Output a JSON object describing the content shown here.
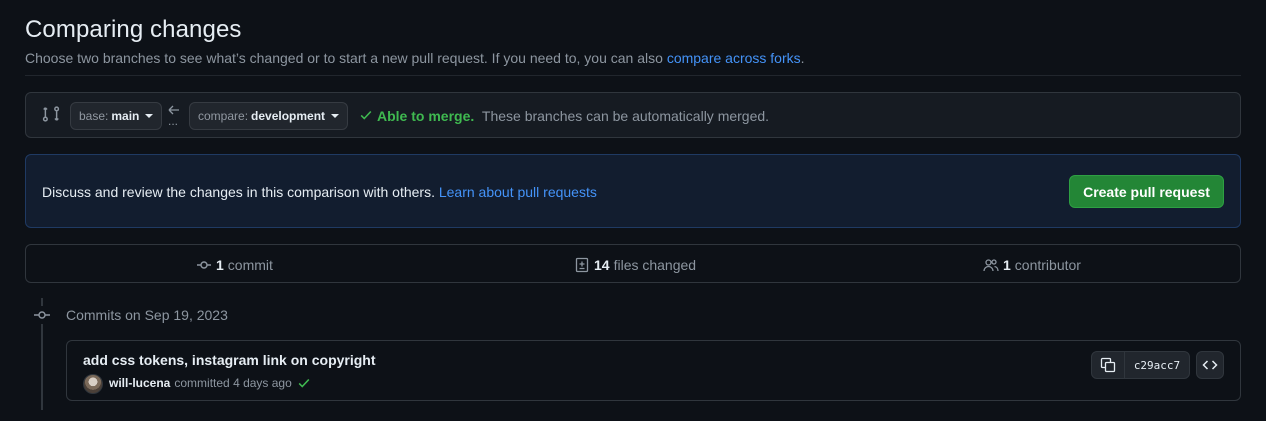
{
  "header": {
    "title": "Comparing changes",
    "subtitle_text": "Choose two branches to see what’s changed or to start a new pull request. If you need to, you can also",
    "subtitle_link": "compare across forks",
    "subtitle_end": "."
  },
  "branch_bar": {
    "base_prefix": "base:",
    "base_value": "main",
    "compare_prefix": "compare:",
    "compare_value": "development",
    "dots": "...",
    "merge_status": "Able to merge.",
    "merge_detail": "These branches can be automatically merged."
  },
  "flash": {
    "text": "Discuss and review the changes in this comparison with others.",
    "link": "Learn about pull requests",
    "button": "Create pull request"
  },
  "summary": {
    "commits_count": "1",
    "commits_label": "commit",
    "files_count": "14",
    "files_label": "files changed",
    "contributors_count": "1",
    "contributors_label": "contributor"
  },
  "timeline": {
    "date_heading": "Commits on Sep 19, 2023",
    "commits": [
      {
        "message": "add css tokens, instagram link on copyright",
        "author": "will-lucena",
        "action": "committed",
        "time": "4 days ago",
        "sha": "c29acc7"
      }
    ]
  },
  "colors": {
    "background": "#0d1117",
    "link": "#4493f8",
    "success": "#3fb950",
    "primary_button": "#238636"
  }
}
